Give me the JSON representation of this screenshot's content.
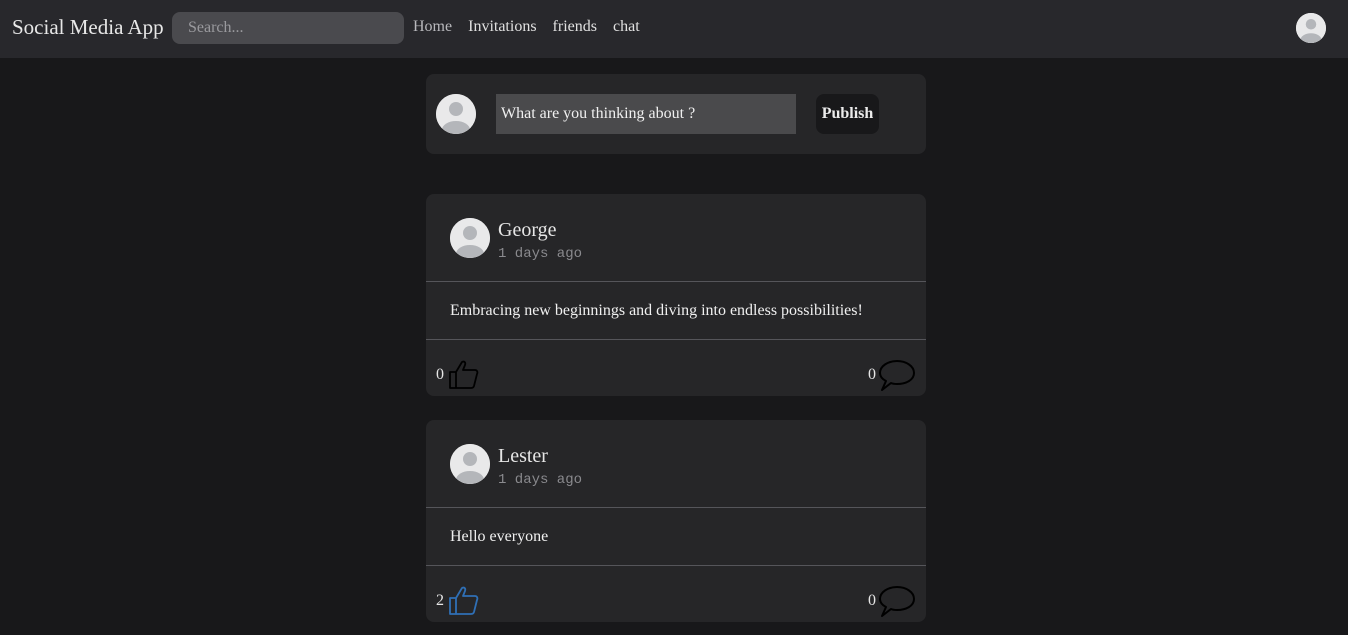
{
  "navbar": {
    "brand": "Social Media App",
    "search_placeholder": "Search...",
    "links": [
      "Home",
      "Invitations",
      "friends",
      "chat"
    ]
  },
  "composer": {
    "placeholder": "What are you thinking about ?",
    "publish_label": "Publish"
  },
  "posts": [
    {
      "author": "George",
      "time": "1 days ago",
      "content": "Embracing new beginnings and diving into endless possibilities!",
      "likes": "0",
      "comments": "0",
      "liked": false
    },
    {
      "author": "Lester",
      "time": "1 days ago",
      "content": "Hello everyone",
      "likes": "2",
      "comments": "0",
      "liked": true
    }
  ],
  "colors": {
    "background": "#18181a",
    "navbar": "#28282c",
    "card": "#262628",
    "liked": "#2f6fb5",
    "unliked": "#000000"
  },
  "icons": {
    "avatar": "user-avatar-icon",
    "like": "thumbs-up-icon",
    "comment": "speech-bubble-icon"
  }
}
